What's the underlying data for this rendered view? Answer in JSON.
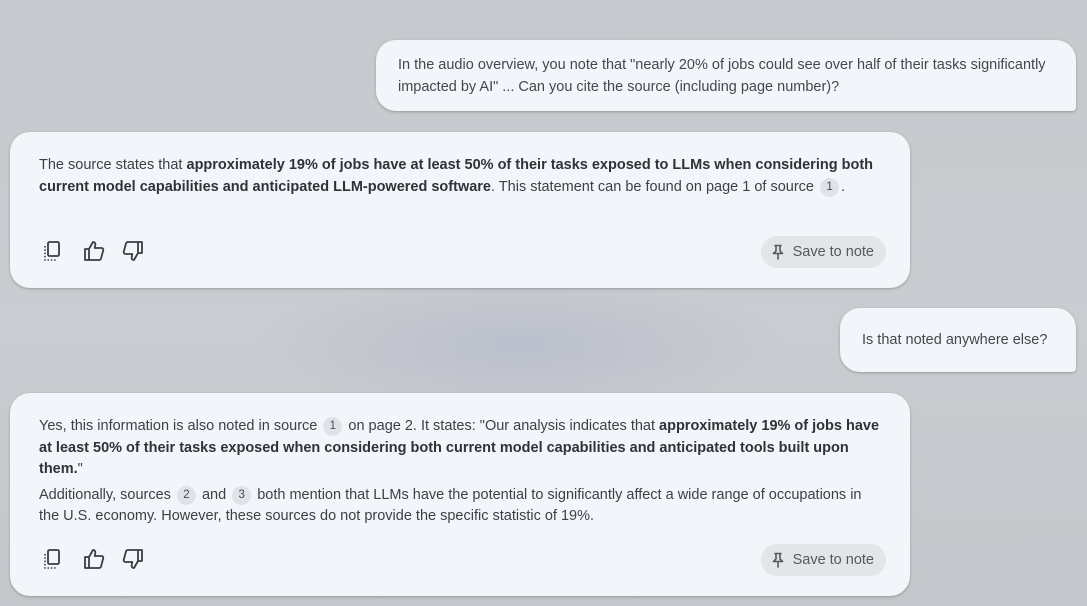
{
  "messages": {
    "q1": {
      "text": "In the audio overview, you note that \"nearly 20% of jobs could see over half of their tasks significantly impacted by AI\" ... Can you cite the source (including page number)?"
    },
    "a1": {
      "p1_a": "The source states that ",
      "p1_bold": "approximately 19% of jobs have at least 50% of their tasks exposed to LLMs when considering both current model capabilities and anticipated LLM-powered software",
      "p1_b": ". This statement can be found on page 1 of source ",
      "p1_cite": "1",
      "p1_end": "."
    },
    "q2": {
      "text": "Is that noted anywhere else?"
    },
    "a2": {
      "p1_a": "Yes, this information is also noted in source ",
      "p1_cite": "1",
      "p1_b": " on page 2. It states: \"Our analysis indicates that ",
      "p1_bold": "approximately 19% of jobs have at least 50% of their tasks exposed when considering both current model capabilities and anticipated tools built upon them.",
      "p1_end": "\"",
      "p2_a": "Additionally, sources ",
      "p2_cite_a": "2",
      "p2_and": " and ",
      "p2_cite_b": "3",
      "p2_b": " both mention that LLMs have the potential to significantly affect a wide range of occupations in the U.S. economy. However, these sources do not provide the specific statistic of 19%."
    }
  },
  "actions": {
    "save_label": "Save to note",
    "icons": [
      "copy-icon",
      "thumbs-up-icon",
      "thumbs-down-icon",
      "pin-icon"
    ]
  },
  "colors": {
    "background": "#c7cace",
    "bubble": "#f3f5fa",
    "citation_chip": "#dfe2e7",
    "save_button": "#e3e5e9",
    "text": "#3c3f44"
  }
}
